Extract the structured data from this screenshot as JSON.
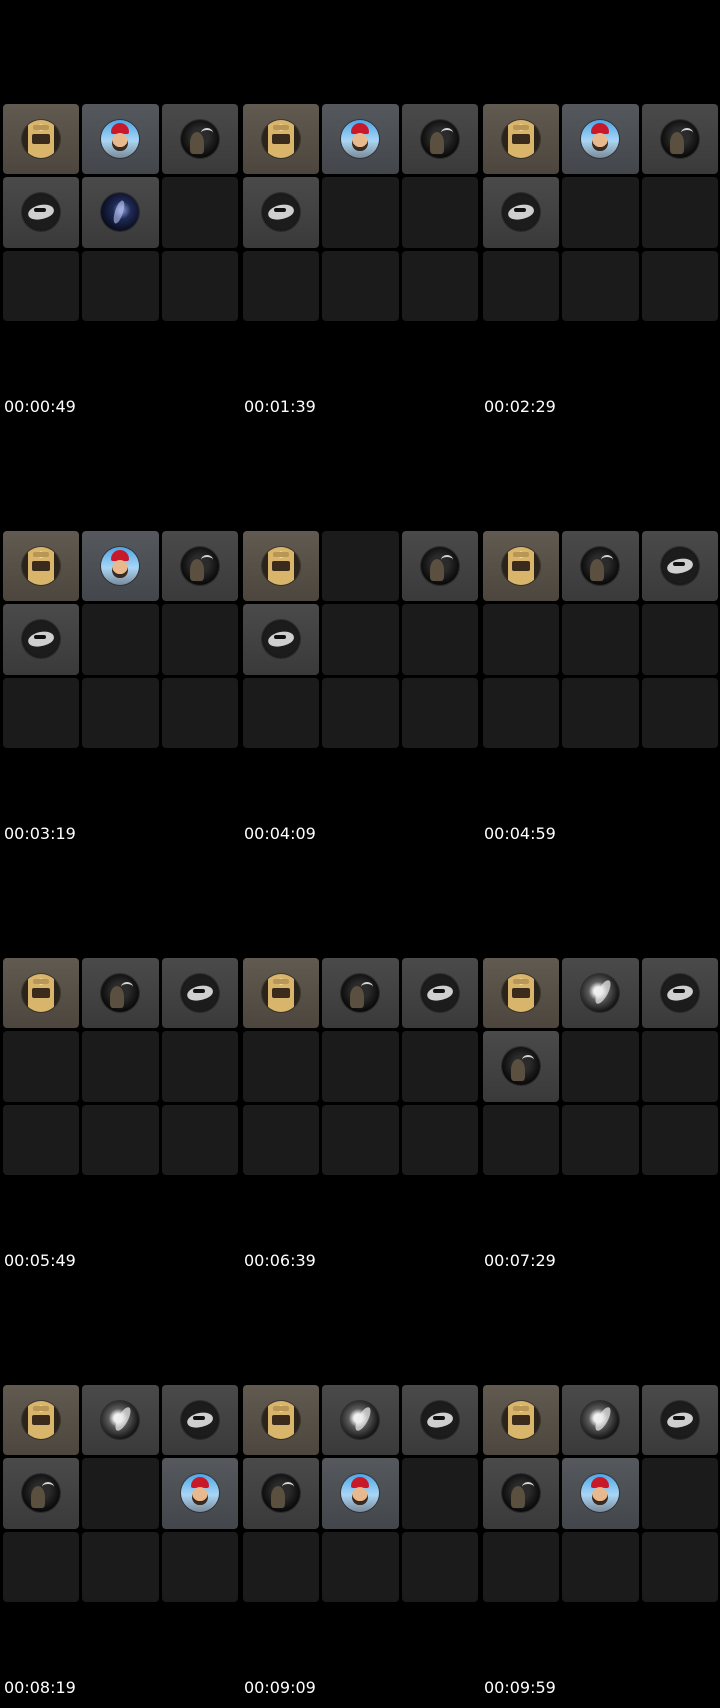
{
  "thumbnails": [
    {
      "timestamp": "00:00:49",
      "tiles": [
        "jar",
        "man",
        "figure",
        "mask",
        "galaxy",
        "",
        "",
        "",
        ""
      ]
    },
    {
      "timestamp": "00:01:39",
      "tiles": [
        "jar",
        "man",
        "figure",
        "mask",
        "",
        "",
        "",
        "",
        ""
      ]
    },
    {
      "timestamp": "00:02:29",
      "tiles": [
        "jar",
        "man",
        "figure",
        "mask",
        "",
        "",
        "",
        "",
        ""
      ]
    },
    {
      "timestamp": "00:03:19",
      "tiles": [
        "jar",
        "man",
        "figure",
        "mask",
        "",
        "",
        "",
        "",
        ""
      ]
    },
    {
      "timestamp": "00:04:09",
      "tiles": [
        "jar",
        "",
        "figure",
        "mask",
        "",
        "",
        "",
        "",
        ""
      ]
    },
    {
      "timestamp": "00:04:59",
      "tiles": [
        "jar",
        "figure",
        "mask",
        "",
        "",
        "",
        "",
        "",
        ""
      ]
    },
    {
      "timestamp": "00:05:49",
      "tiles": [
        "jar",
        "figure",
        "mask",
        "",
        "",
        "",
        "",
        "",
        ""
      ]
    },
    {
      "timestamp": "00:06:39",
      "tiles": [
        "jar",
        "figure",
        "mask",
        "",
        "",
        "",
        "",
        "",
        ""
      ]
    },
    {
      "timestamp": "00:07:29",
      "tiles": [
        "jar",
        "bw",
        "mask",
        "figure",
        "",
        "",
        "",
        "",
        ""
      ]
    },
    {
      "timestamp": "00:08:19",
      "tiles": [
        "jar",
        "bw",
        "mask",
        "figure",
        "",
        "man",
        "",
        "",
        ""
      ]
    },
    {
      "timestamp": "00:09:09",
      "tiles": [
        "jar",
        "bw",
        "mask",
        "figure",
        "man",
        "",
        "",
        "",
        ""
      ]
    },
    {
      "timestamp": "00:09:59",
      "tiles": [
        "jar",
        "bw",
        "mask",
        "figure",
        "man",
        "",
        "",
        "",
        ""
      ]
    }
  ]
}
